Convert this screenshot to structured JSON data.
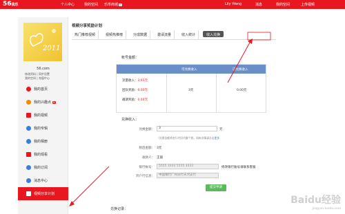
{
  "topbar": {
    "logo": "56",
    "logo_suffix": ".com",
    "logo_cn": "我乐",
    "nav": [
      "个人中心",
      "我的空间",
      "乐币商城"
    ],
    "nav_badge": "N",
    "right": [
      "Lily Wang",
      "消息",
      "我的空间",
      "上传视频"
    ]
  },
  "sidebar": {
    "username": "56.com",
    "links": [
      "修改资料 | 同步设置",
      "我的空间 | 充值中心"
    ],
    "menu": [
      {
        "label": "我的首页",
        "icon": "home-icon",
        "color": "#e8161f"
      },
      {
        "label": "我的兴趣点",
        "icon": "interest-icon",
        "color": "#f08c00",
        "hot": "N"
      },
      {
        "label": "我的视频",
        "icon": "video-icon",
        "color": "#e8161f"
      },
      {
        "label": "我的专辑",
        "icon": "album-icon",
        "color": "#3b7dd8"
      },
      {
        "label": "我的相册",
        "icon": "photo-icon",
        "color": "#3b7dd8"
      },
      {
        "label": "我的观看",
        "icon": "watch-icon",
        "color": "#e8161f"
      },
      {
        "label": "我的订阅",
        "icon": "subscribe-icon",
        "color": "#3b7dd8"
      },
      {
        "label": "消息中心",
        "icon": "message-icon",
        "color": "#3b7dd8"
      },
      {
        "label": "视频分享计划",
        "icon": "share-icon",
        "color": "#fff",
        "active": true
      }
    ]
  },
  "main": {
    "title": "视频分享奖励计划",
    "tabs": [
      "热门推荐视频",
      "视频热推榜",
      "分成数据",
      "邀请流量",
      "收入统计",
      "收入兑换"
    ],
    "account_label": "帐号金额：",
    "table_headers": [
      "可兑换收入",
      "已兑换收入"
    ],
    "rows": [
      {
        "label": "流量收入：",
        "value": "3.65元"
      },
      {
        "label": "团队奖励：",
        "value": "0.00元"
      },
      {
        "label": "邀请奖励：",
        "value": "0.00元"
      }
    ],
    "redeemable": "3元",
    "redeemed": "0.00元",
    "exchange_label": "兑换收入：",
    "amount_label": "兑换金额：",
    "amount_value": "3",
    "amount_unit": "元",
    "amount_hint": "（兑换金额将进行代扣代缴个税，如有详情请点击",
    "amount_hint_link": "更多",
    "after_tax_label": "税后金额：",
    "after_tax_value": "3元",
    "payee_label": "收款人：",
    "payee_value": "王丽",
    "bank_label": "银行帐号：",
    "bank_value": "5555 3333 5555 3333",
    "bank_hint": "修改银行账号请联系客服",
    "bank_info_label": "开户行信息：",
    "bank_info_value": "中国银行广州分行天河支行",
    "apply_button": "提交申请",
    "record_label": "兑换记录："
  },
  "watermark": "Baidu经验",
  "watermark_sub": "jingyan.baidu.com"
}
